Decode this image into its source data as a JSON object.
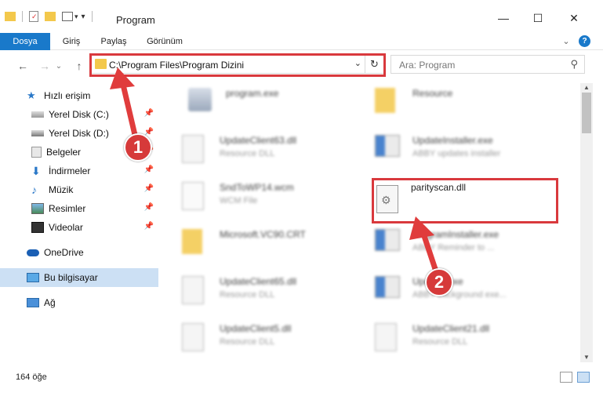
{
  "window": {
    "title": "Program",
    "minimize_glyph": "—",
    "maximize_glyph": "☐",
    "close_glyph": "✕"
  },
  "ribbon": {
    "tabs": [
      {
        "label": "Dosya"
      },
      {
        "label": "Giriş"
      },
      {
        "label": "Paylaş"
      },
      {
        "label": "Görünüm"
      }
    ],
    "expand_glyph": "⌄",
    "help_glyph": "?"
  },
  "nav": {
    "back_glyph": "←",
    "forward_glyph": "→",
    "recent_glyph": "⌄",
    "up_glyph": "↑",
    "address": "C:\\Program Files\\Program Dizini",
    "dropdown_glyph": "⌄",
    "refresh_glyph": "↻",
    "search_placeholder": "Ara: Program",
    "search_glyph": "⚲"
  },
  "sidebar": {
    "items": [
      {
        "label": "Hızlı erişim",
        "icon": "star-icon",
        "pinned": false
      },
      {
        "label": "Yerel Disk (C:)",
        "icon": "drive-icon",
        "pinned": true
      },
      {
        "label": "Yerel Disk (D:)",
        "icon": "drive-icon",
        "pinned": true
      },
      {
        "label": "Belgeler",
        "icon": "documents-icon",
        "pinned": true
      },
      {
        "label": "İndirmeler",
        "icon": "download-icon",
        "pinned": true
      },
      {
        "label": "Müzik",
        "icon": "music-icon",
        "pinned": true
      },
      {
        "label": "Resimler",
        "icon": "pictures-icon",
        "pinned": true
      },
      {
        "label": "Videolar",
        "icon": "video-icon",
        "pinned": true
      },
      {
        "label": "OneDrive",
        "icon": "cloud-icon",
        "pinned": false
      },
      {
        "label": "Bu bilgisayar",
        "icon": "computer-icon",
        "pinned": false
      },
      {
        "label": "Ağ",
        "icon": "network-icon",
        "pinned": false
      }
    ],
    "pin_glyph": "📌"
  },
  "files": [
    {
      "name": "program.exe",
      "desc": "",
      "icon": "app-icon"
    },
    {
      "name": "Resource",
      "desc": "",
      "icon": "folder-icon"
    },
    {
      "name": "UpdateClient63.dll",
      "desc": "Resource DLL",
      "icon": "dll-icon"
    },
    {
      "name": "UpdateInstaller.exe",
      "desc": "ABBY updates installer",
      "icon": "installer-icon"
    },
    {
      "name": "SndToWP14.wcm",
      "desc": "WCM File",
      "icon": "file-icon"
    },
    {
      "name": "parityscan.dll",
      "desc": "",
      "icon": "dll-icon"
    },
    {
      "name": "Microsoft.VC90.CRT",
      "desc": "",
      "icon": "folder-icon"
    },
    {
      "name": "ProgramInstaller.exe",
      "desc": "ABBY Reminder to ...",
      "icon": "installer-icon"
    },
    {
      "name": "UpdateClient65.dll",
      "desc": "Resource DLL",
      "icon": "dll-icon"
    },
    {
      "name": "Updater.exe",
      "desc": "ABBY background exe...",
      "icon": "installer-icon"
    },
    {
      "name": "UpdateClient5.dll",
      "desc": "Resource DLL",
      "icon": "dll-icon"
    },
    {
      "name": "UpdateClient21.dll",
      "desc": "Resource DLL",
      "icon": "dll-icon"
    }
  ],
  "status": {
    "count": "164 öğe"
  },
  "annotations": {
    "step1": "1",
    "step2": "2"
  },
  "colors": {
    "accent": "#1979ca",
    "highlight": "#d9393d"
  }
}
